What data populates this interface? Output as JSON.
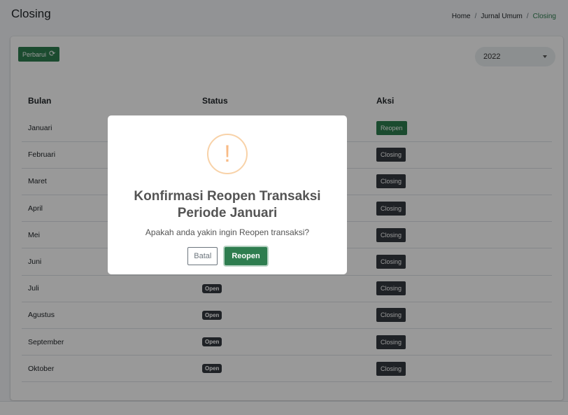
{
  "header": {
    "title": "Closing",
    "breadcrumb": [
      "Home",
      "Jurnal Umum",
      "Closing"
    ],
    "separator": "/"
  },
  "toolbar": {
    "refresh_label": "Perbarui",
    "refresh_icon": "refresh-icon",
    "year_value": "2022"
  },
  "table": {
    "headers": [
      "Bulan",
      "Status",
      "Aksi"
    ],
    "rows": [
      {
        "month": "Januari",
        "status": "",
        "action": "Reopen"
      },
      {
        "month": "Februari",
        "status": "",
        "action": "Closing"
      },
      {
        "month": "Maret",
        "status": "",
        "action": "Closing"
      },
      {
        "month": "April",
        "status": "",
        "action": "Closing"
      },
      {
        "month": "Mei",
        "status": "",
        "action": "Closing"
      },
      {
        "month": "Juni",
        "status": "",
        "action": "Closing"
      },
      {
        "month": "Juli",
        "status": "Open",
        "action": "Closing"
      },
      {
        "month": "Agustus",
        "status": "Open",
        "action": "Closing"
      },
      {
        "month": "September",
        "status": "Open",
        "action": "Closing"
      },
      {
        "month": "Oktober",
        "status": "Open",
        "action": "Closing"
      }
    ]
  },
  "modal": {
    "icon": "exclamation-icon",
    "icon_glyph": "!",
    "title_line1": "Konfirmasi Reopen Transaksi",
    "title_line2": "Periode Januari",
    "text": "Apakah anda yakin ingin Reopen transaksi?",
    "cancel_label": "Batal",
    "confirm_label": "Reopen"
  },
  "colors": {
    "accent": "#2e7d4f",
    "dark": "#343a40",
    "warning": "#f8bb86"
  }
}
